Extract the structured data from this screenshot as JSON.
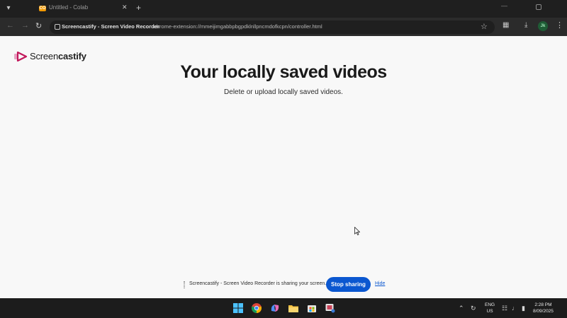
{
  "browser": {
    "tab": {
      "title": "Untitled - Colab",
      "favicon": "CO"
    },
    "omnibox": {
      "site_name": "Screencastify - Screen Video Recorder",
      "url": "chrome-extension://mmeijimgabbpbgpdklnllpncmdofkcpn/controller.html"
    },
    "profile_initials": "Jk"
  },
  "page": {
    "logo_text_regular": "Screen",
    "logo_text_bold": "castify",
    "title": "Your locally saved videos",
    "subtitle": "Delete or upload locally saved videos."
  },
  "share_bar": {
    "message": "Screencastify - Screen Video Recorder is sharing your screen.",
    "stop_label": "Stop sharing",
    "hide_label": "Hide"
  },
  "taskbar": {
    "lang_line1": "ENG",
    "lang_line2": "US",
    "time": "2:28 PM",
    "date": "8/09/2025"
  },
  "colors": {
    "accent": "#0b57d0",
    "brand": "#c2185b",
    "taskbar": "#1c1c1c",
    "browser_frame": "#1f1f1f"
  }
}
